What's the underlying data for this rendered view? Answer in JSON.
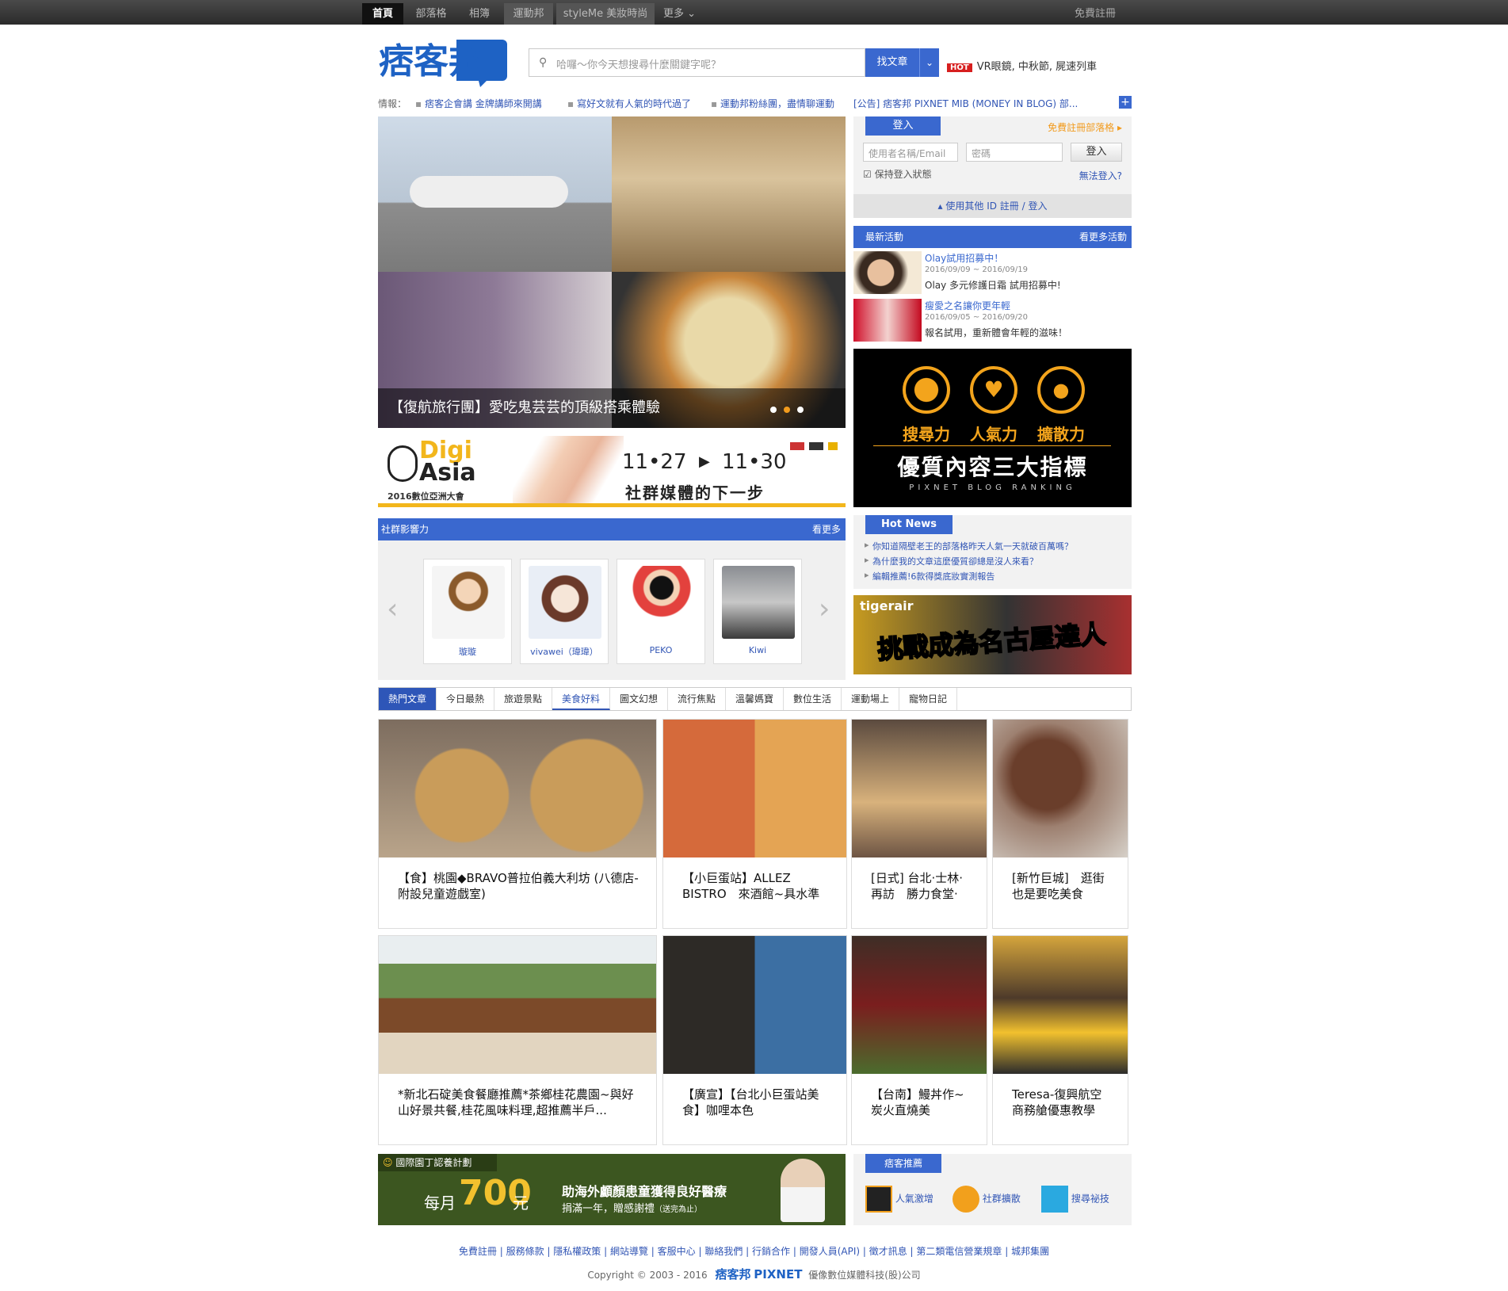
{
  "topbar": {
    "tabs": [
      "首頁",
      "部落格",
      "相簿",
      "運動邦",
      "styleMe 美妝時尚",
      "更多"
    ],
    "register": "免費註冊"
  },
  "header": {
    "logo_text": "痞客邦",
    "search_placeholder": "哈囉～你今天想搜尋什麼關鍵字呢？",
    "search_button": "找文章",
    "hot_tag": "HOT",
    "hot_text": "VR眼鏡, 中秋節, 屍速列車"
  },
  "news": {
    "label": "情報：",
    "items": [
      "痞客企會講 金牌講師來開講",
      "寫好文就有人氣的時代過了",
      "運動邦粉絲團，盡情聊運動",
      "[公告] 痞客邦 PIXNET MIB (MONEY IN BLOG) 部..."
    ]
  },
  "slider": {
    "caption": "【復航旅行團】愛吃鬼芸芸的頂級搭乘體驗"
  },
  "banner_digiasia": {
    "brand_line1": "Digi",
    "brand_line2": "Asia",
    "sub": "2016數位亞洲大會",
    "date_start": "11•27",
    "date_end": "11•30",
    "tagline": "社群媒體的下一步"
  },
  "login": {
    "tab": "登入",
    "register_link": "免費註冊部落格",
    "username_placeholder": "使用者名稱/Email",
    "password_placeholder": "密碼",
    "login_button": "登入",
    "remember": "保持登入狀態",
    "forgot": "無法登入?",
    "other_id": "使用其他 ID 註冊 / 登入"
  },
  "activities": {
    "title": "最新活動",
    "more": "看更多活動",
    "items": [
      {
        "title": "Olay試用招募中！",
        "date": "2016/09/09 ~ 2016/09/19",
        "desc": "Olay 多元修護日霜 試用招募中!"
      },
      {
        "title": "瘦愛之名讓你更年輕",
        "date": "2016/09/05 ~ 2016/09/20",
        "desc": "報名試用，重新體會年輕的滋味！"
      }
    ]
  },
  "ranking_banner": {
    "items": [
      "搜尋力",
      "人氣力",
      "擴散力"
    ],
    "title": "優質內容三大指標",
    "sub": "PIXNET BLOG RANKING"
  },
  "social": {
    "title": "社群影響力",
    "more": "看更多",
    "users": [
      "璇璇",
      "vivawei（瑋瑋）",
      "PEKO",
      "Kiwi"
    ]
  },
  "hotnews": {
    "title": "Hot News",
    "items": [
      "你知道隔壁老王的部落格昨天人氣一天就破百萬嗎？",
      "為什麼我的文章這麼優質卻總是沒人來看？",
      "編輯推薦!6款得獎底妝實測報告"
    ]
  },
  "tiger_banner": {
    "brand": "tigerair",
    "text": "挑戰成為名古屋達人"
  },
  "category_tabs": [
    "熱門文章",
    "今日最熱",
    "旅遊景點",
    "美食好料",
    "圖文幻想",
    "流行焦點",
    "溫馨媽寶",
    "數位生活",
    "運動場上",
    "寵物日記"
  ],
  "posts": [
    "【食】桃園◆BRAVO普拉伯義大利坊 (八德店-附設兒童遊戲室)",
    "【小巨蛋站】ALLEZ BISTRO　來酒館~具水準",
    "[日式] 台北·士林·再訪　勝力食堂·",
    "[新竹巨城]　逛街也是要吃美食",
    "*新北石碇美食餐廳推薦*茶鄉桂花農園~與好山好景共餐,桂花風味料理,超推薦半戶...",
    "【廣宣】【台北小巨蛋站美食】咖哩本色",
    "【台南】鰻丼作~炭火直燒美",
    "Teresa-復興航空商務艙優惠教學"
  ],
  "gardener": {
    "title": "國際園丁認養計劃",
    "monthly": "每月",
    "amount": "700",
    "unit": "元",
    "line1": "助海外顱顏患童獲得良好醫療",
    "line2": "捐滿一年，贈感謝禮",
    "note": "（送完為止）"
  },
  "recommend": {
    "title": "痞客推薦",
    "items": [
      "人氣激增",
      "社群擴散",
      "搜尋祕技"
    ]
  },
  "footer": {
    "links": [
      "免費註冊",
      "服務條款",
      "隱私權政策",
      "網站導覽",
      "客服中心",
      "聯絡我們",
      "行銷合作",
      "開發人員(API)",
      "徵才訊息",
      "第二類電信營業規章",
      "城邦集團"
    ],
    "copyright": "Copyright © 2003 - 2016",
    "company": "優像數位媒體科技(股)公司",
    "brand_cn": "痞客邦",
    "brand_en": "PIXNET"
  },
  "colors": {
    "brand_blue": "#3a68cf",
    "hot_red": "#d71f1f",
    "digi_yellow": "#f2b61c"
  }
}
